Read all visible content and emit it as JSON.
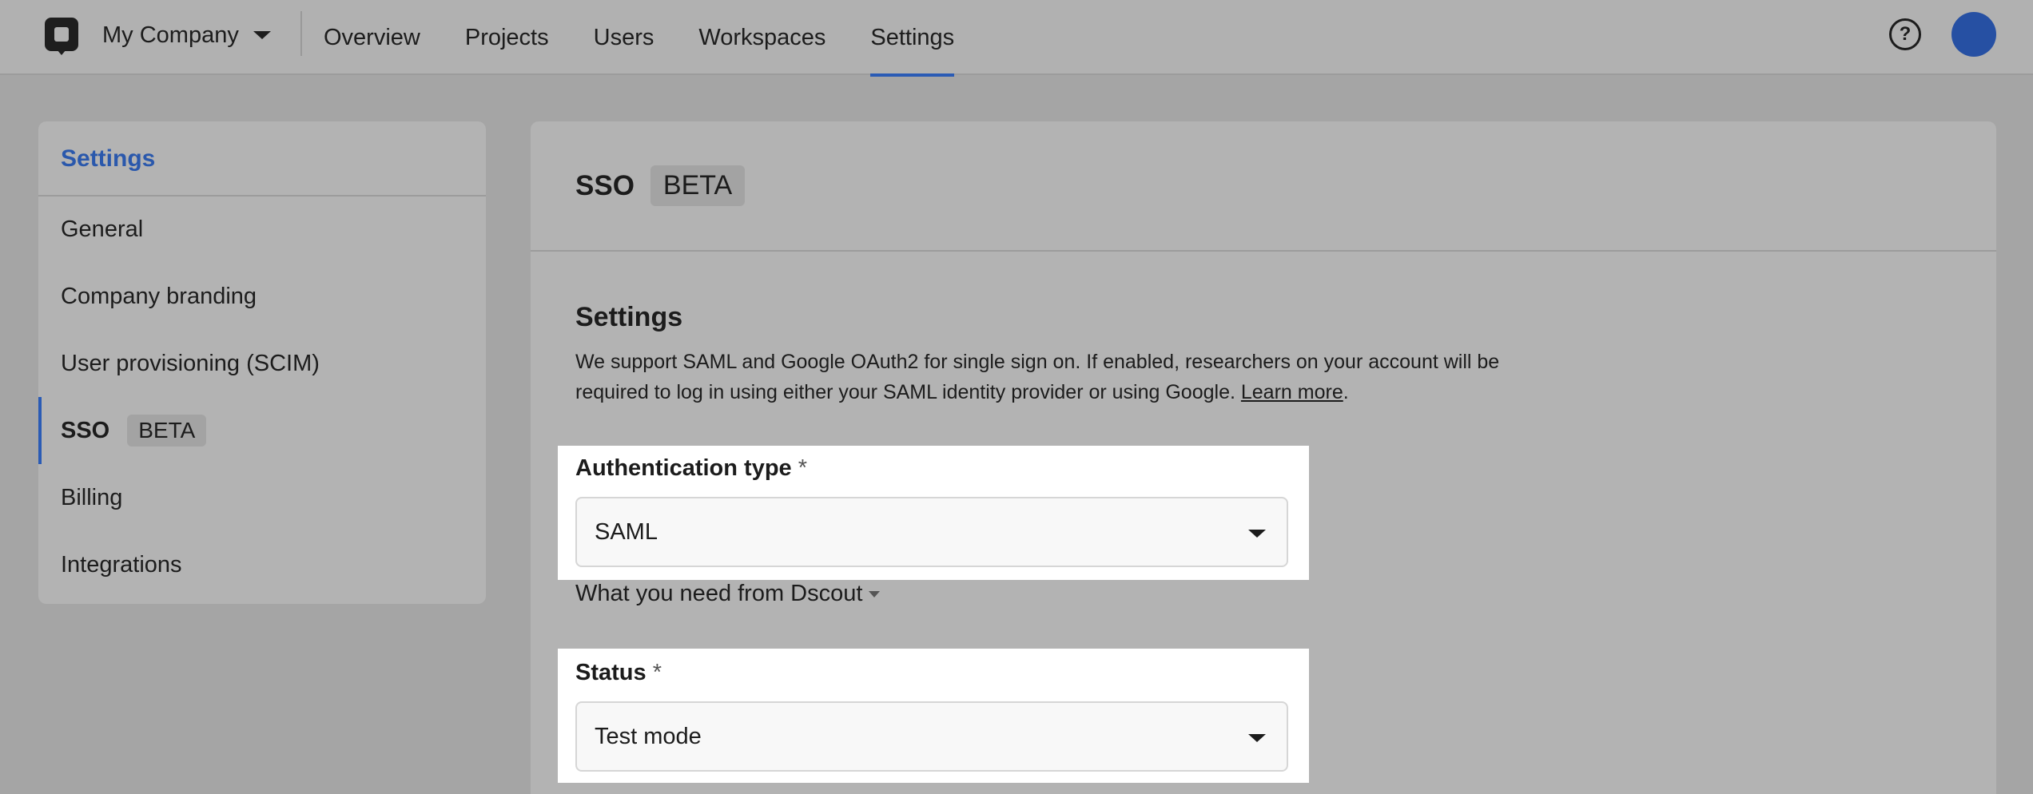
{
  "nav": {
    "company": "My Company",
    "links": [
      "Overview",
      "Projects",
      "Users",
      "Workspaces",
      "Settings"
    ],
    "active": "Settings",
    "help_icon": "?",
    "accent": "#2a5bb5"
  },
  "sidebar": {
    "title": "Settings",
    "items": [
      {
        "label": "General"
      },
      {
        "label": "Company branding"
      },
      {
        "label": "User provisioning (SCIM)"
      },
      {
        "label": "SSO",
        "badge": "BETA"
      },
      {
        "label": "Billing"
      },
      {
        "label": "Integrations"
      }
    ]
  },
  "main": {
    "title": "SSO",
    "badge": "BETA",
    "section_title": "Settings",
    "description": "We support SAML and Google OAuth2 for single sign on. If enabled, researchers on your account will be required to log in using either your SAML identity provider or using Google.",
    "learn_more": "Learn more",
    "period": ".",
    "auth_type": {
      "label": "Authentication type",
      "required": "*",
      "value": "SAML"
    },
    "disclosure": "What you need from Dscout",
    "status": {
      "label": "Status",
      "required": "*",
      "value": "Test mode"
    }
  }
}
